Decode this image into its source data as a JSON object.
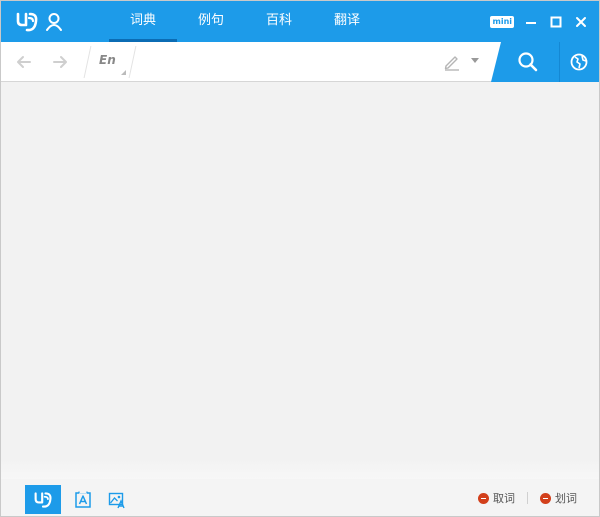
{
  "titlebar": {
    "tabs": [
      {
        "label": "词典",
        "active": true
      },
      {
        "label": "例句",
        "active": false
      },
      {
        "label": "百科",
        "active": false
      },
      {
        "label": "翻译",
        "active": false
      }
    ],
    "mini_label": "mini"
  },
  "toolbar": {
    "lang_label": "En",
    "search_value": "",
    "search_placeholder": ""
  },
  "bottom": {
    "toggles": [
      {
        "label": "取词"
      },
      {
        "label": "划词"
      }
    ]
  },
  "colors": {
    "accent": "#1d9be9",
    "active_tab_underline": "#0b6cb4",
    "content_bg": "#f2f2f2",
    "toggle_off": "#d23f1b"
  },
  "icons": {
    "logo": "youdao-logo-icon",
    "user": "user-icon",
    "minimize": "minimize-icon",
    "maximize": "maximize-icon",
    "close": "close-icon",
    "back": "arrow-left-icon",
    "forward": "arrow-right-icon",
    "handwrite": "pen-icon",
    "dropdown": "caret-down-icon",
    "search": "search-icon",
    "globe": "globe-icon",
    "dict_mode": "dict-mode-icon",
    "ocr": "ocr-icon",
    "image_translate": "image-translate-icon"
  }
}
